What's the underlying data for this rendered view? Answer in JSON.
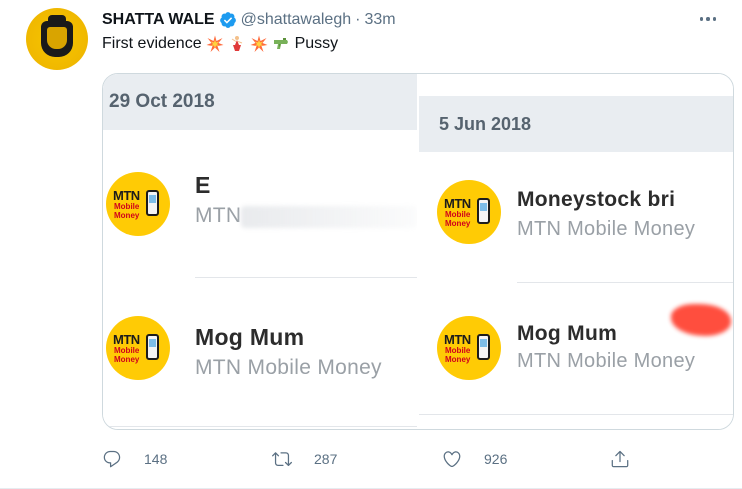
{
  "tweet": {
    "display_name": "SHATTA WALE",
    "handle": "@shattawalegh",
    "separator": "·",
    "time": "33m",
    "text_before": "First evidence",
    "text_after": "Pussy",
    "emojis": [
      "collision-emoji",
      "dancer-emoji",
      "collision-emoji",
      "water-pistol-emoji"
    ]
  },
  "media": {
    "left": {
      "date": "29 Oct 2018",
      "rows": [
        {
          "title": "E",
          "subtitle": "MTN"
        },
        {
          "title": "Mog Mum",
          "subtitle": "MTN Mobile Money"
        }
      ]
    },
    "right": {
      "date": "5 Jun 2018",
      "rows": [
        {
          "title": "Moneystock bri",
          "subtitle": "MTN Mobile Money"
        },
        {
          "title": "Mog Mum",
          "subtitle": "MTN Mobile Money"
        }
      ]
    },
    "logo": {
      "brand": "MTN",
      "line1": "Mobile",
      "line2": "Money"
    }
  },
  "actions": {
    "reply_count": "148",
    "retweet_count": "287",
    "like_count": "926"
  },
  "colors": {
    "accent": "#1d9bf0",
    "mtn_yellow": "#ffcb05",
    "muted": "#5b7083"
  }
}
